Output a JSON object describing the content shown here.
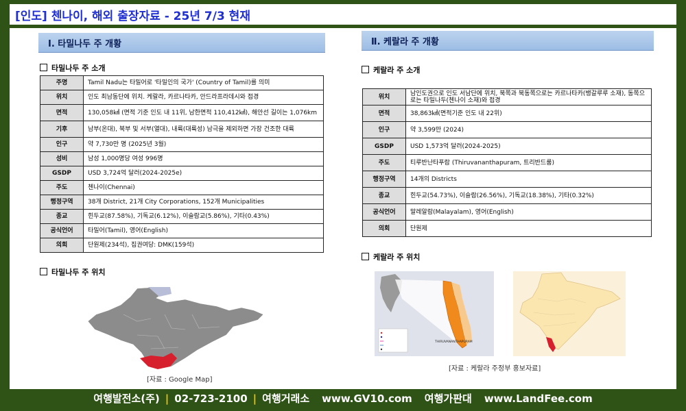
{
  "title": "[인도] 첸나이, 해외 출장자료 - 25년 7/3 현재",
  "left": {
    "header": "Ⅰ. 타밀나두 주 개황",
    "intro_heading": "타밀나두 주 소개",
    "rows": [
      {
        "key": "주명",
        "value": "Tamil Nadu는 타밀어로 '타밀인의 국가' (Country of Tamil)를 의미"
      },
      {
        "key": "위치",
        "value": "인도 최남동단에 위치. 케랄라, 카르나타카, 안드라프라데시와 접경"
      },
      {
        "key": "면적",
        "value": "130,058㎢ (면적 기준 인도 내 11위, 남한면적 110,412㎢), 해안선 길이는 1,076km"
      },
      {
        "key": "기후",
        "value": "남부(온대), 북부 및 서부(열대), 내륙(대륙성) 남극을 제외하면 가장 건조한 대륙"
      },
      {
        "key": "인구",
        "value": "약 7,730만 명 (2025년 3월)"
      },
      {
        "key": "성비",
        "value": "남성 1,000명당 여성 996명"
      },
      {
        "key": "GSDP",
        "value": "USD 3,724억 달러(2024-2025e)"
      },
      {
        "key": "주도",
        "value": "첸나이(Chennai)"
      },
      {
        "key": "행정구역",
        "value": "38개 District, 21개 City Corporations, 152개 Municipalities"
      },
      {
        "key": "종교",
        "value": "힌두교(87.58%), 기독교(6.12%), 이슬람교(5.86%), 기타(0.43%)"
      },
      {
        "key": "공식언어",
        "value": "타밀어(Tamil), 영어(English)"
      },
      {
        "key": "의회",
        "value": "단원제(234석), 집권여당: DMK(159석)"
      }
    ],
    "location_heading": "타밀나두 주 위치",
    "map_caption": "[자료 : Google Map]"
  },
  "right": {
    "header": "Ⅱ. 케랄라 주 개황",
    "intro_heading": "케랄라 주 소개",
    "rows": [
      {
        "key": "위치",
        "value": "남인도권으로 인도 서남단에 위치, 북쪽과 북동쪽으로는 카르나타카(뱅갈루루 소재), 동쪽으로는 타밀나두(첸나이 소재)와 접경"
      },
      {
        "key": "면적",
        "value": "38,863㎢(면적기준 인도 내 22위)"
      },
      {
        "key": "인구",
        "value": "약 3,599만 (2024)"
      },
      {
        "key": "GSDP",
        "value": "USD 1,573억 달러(2024-2025)"
      },
      {
        "key": "주도",
        "value": "티루반난타푸람 (Thiruvananthapuram, 트리반드룸)"
      },
      {
        "key": "행정구역",
        "value": "14개의 Districts"
      },
      {
        "key": "종교",
        "value": "힌두교(54.73%), 이슬람(26.56%), 기독교(18.38%), 기타(0.32%)"
      },
      {
        "key": "공식언어",
        "value": "말레알람(Malayalam), 영어(English)"
      },
      {
        "key": "의회",
        "value": "단원제"
      }
    ],
    "location_heading": "케랄라 주 위치",
    "map_caption": "[자료 : 케랄라 주정부 홍보자료]",
    "map_label": "THIRUVANANTHAPURAM"
  },
  "footer": {
    "company": "여행발전소(주)",
    "phone": "02-723-2100",
    "label1": "여행거래소",
    "site1": "www.GV10.com",
    "label2": "여행가판대",
    "site2": "www.LandFee.com"
  },
  "colors": {
    "background": "#2f5317",
    "title": "#1f2fd0",
    "header_fill": "#a9c6ea",
    "tamil_highlight": "#d6202e",
    "kerala_highlight": "#f08a1c",
    "footer_separator": "#f5c400"
  }
}
